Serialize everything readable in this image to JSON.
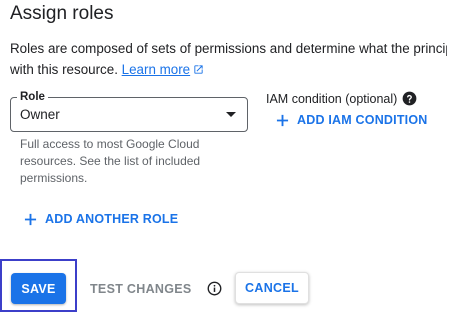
{
  "dialog": {
    "title": "Assign roles",
    "description_line1": "Roles are composed of sets of permissions and determine what the principa",
    "description_line2": "with this resource.",
    "learn_more": "Learn more"
  },
  "role_field": {
    "label": "Role",
    "value": "Owner",
    "helper_text": "Full access to most Google Cloud resources. See the list of included permissions."
  },
  "iam_condition": {
    "label": "IAM condition (optional)",
    "add_button": "ADD IAM CONDITION"
  },
  "add_another_role": "ADD ANOTHER ROLE",
  "actions": {
    "save": "SAVE",
    "test_changes": "TEST CHANGES",
    "cancel": "CANCEL"
  },
  "icons": {
    "external_link": "external-link-icon",
    "help": "help-circle-icon",
    "plus": "plus-icon",
    "info": "info-icon",
    "dropdown": "arrow-drop-down-icon"
  },
  "colors": {
    "primary": "#1a73e8",
    "text": "#202124",
    "secondary_text": "#5f6368",
    "disabled_text": "#80868b",
    "focus_ring": "#3c3fc9"
  }
}
